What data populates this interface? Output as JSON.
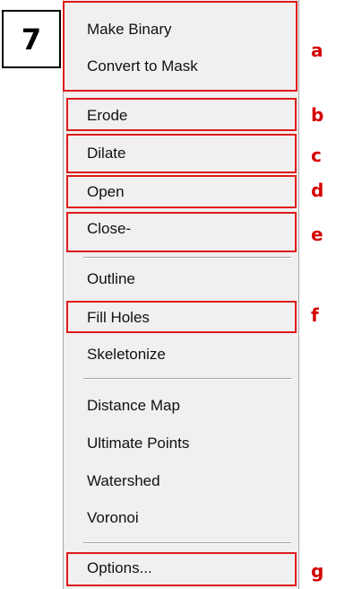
{
  "step_label": "7",
  "menu": {
    "items": [
      {
        "label": "Make Binary"
      },
      {
        "label": "Convert to Mask"
      },
      {
        "label": "Erode"
      },
      {
        "label": "Dilate"
      },
      {
        "label": "Open"
      },
      {
        "label": "Close-"
      },
      {
        "label": "Outline"
      },
      {
        "label": "Fill Holes"
      },
      {
        "label": "Skeletonize"
      },
      {
        "label": "Distance Map"
      },
      {
        "label": "Ultimate Points"
      },
      {
        "label": "Watershed"
      },
      {
        "label": "Voronoi"
      },
      {
        "label": "Options..."
      }
    ]
  },
  "annotations": [
    "a",
    "b",
    "c",
    "d",
    "e",
    "f",
    "g"
  ],
  "colors": {
    "highlight": "#e01a1a",
    "annotation_text": "#d40000",
    "menu_bg": "#f0f0f0"
  }
}
